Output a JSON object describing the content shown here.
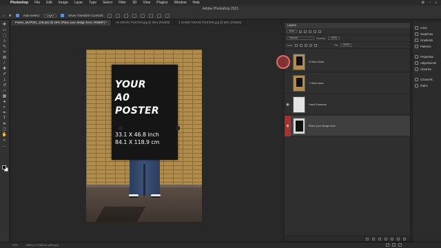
{
  "menubar": {
    "app": "Photoshop",
    "items": [
      "File",
      "Edit",
      "Image",
      "Layer",
      "Type",
      "Select",
      "Filter",
      "3D",
      "View",
      "Plugins",
      "Window",
      "Help"
    ]
  },
  "window_title": "Adobe Photoshop 2021",
  "options_bar": {
    "auto_select_label": "Auto-Select:",
    "auto_select_value": "Layer",
    "show_transform_label": "Show Transform Controls"
  },
  "tabs": [
    {
      "label": "Poster_MUP001_12B.psd @ 25% (Place your design here, RGB/8*) *",
      "active": true
    },
    {
      "label": "A0 MOVIE POSTER.jpg @ 50% (RGB/8)",
      "active": false
    },
    {
      "label": "1 SHEET MOVIE POSTER.jpg @ 50% (RGB/8)",
      "active": false
    }
  ],
  "canvas": {
    "headline": "YOUR\nA0\nPOSTER",
    "dimensions_line1": "33.1 X 46.8 inch",
    "dimensions_line2": "84.1 X 118.9 cm"
  },
  "layers_panel": {
    "title": "Layers",
    "filter_value": "Kind",
    "blend_mode": "Normal",
    "opacity_label": "Opacity:",
    "opacity_value": "100%",
    "lock_label": "Lock:",
    "fill_label": "Fill:",
    "fill_value": "100%",
    "layers": [
      {
        "name": "A Shoe Mask",
        "visible": false,
        "thumb": "photo",
        "selected": false
      },
      {
        "name": "Y Shoe base",
        "visible": false,
        "thumb": "photo",
        "selected": false
      },
      {
        "name": "Hand Shadows",
        "visible": true,
        "thumb": "white",
        "selected": false
      },
      {
        "name": "Place your design here",
        "visible": true,
        "thumb": "black",
        "selected": true
      }
    ]
  },
  "side_panels": {
    "group1": [
      "Color",
      "Swatches",
      "Gradients",
      "Patterns"
    ],
    "group2": [
      "Properties",
      "Adjustments",
      "Libraries"
    ],
    "group3": [
      "Channels",
      "Paths"
    ]
  },
  "status_bar": {
    "zoom": "25%",
    "doc_size": "3960 px x 6100 px (300 ppi)"
  }
}
